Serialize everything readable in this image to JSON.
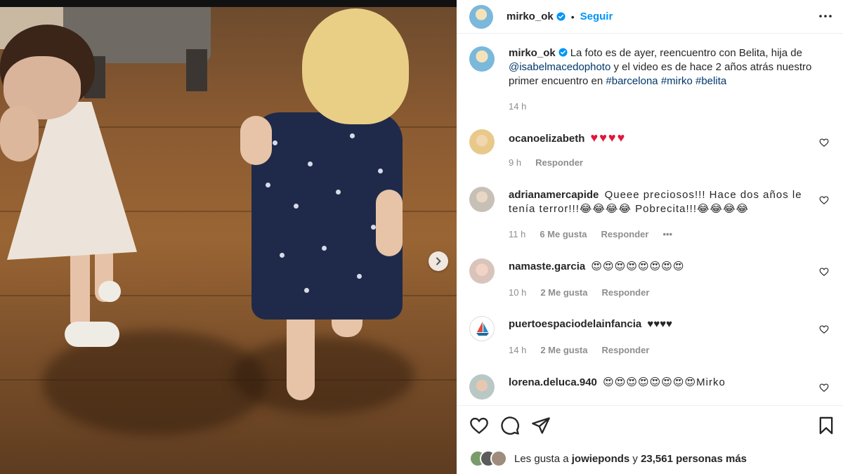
{
  "post": {
    "username": "mirko_ok",
    "dot": "•",
    "follow_label": "Seguir",
    "caption_parts": {
      "text1": "La foto es de ayer, reencuentro con Belita, hija de ",
      "mention": "@isabelmacedophoto",
      "text2": " y el video es de hace 2 años atrás nuestro primer encuentro en ",
      "tag1": "#barcelona",
      "tag2": "#mirko",
      "tag3": "#belita"
    },
    "caption_time": "14 h"
  },
  "comments": [
    {
      "user": "ocanoelizabeth",
      "text": "",
      "hearts": "♥♥♥♥",
      "time": "9 h",
      "likes": "",
      "reply": "Responder"
    },
    {
      "user": "adrianamercapide",
      "text": "Queee preciosos!!! Hace dos años le tenía terror!!!😂😂😂😂 Pobrecita!!!😂😂😂😂",
      "time": "11 h",
      "likes": "6 Me gusta",
      "reply": "Responder",
      "more": "•••"
    },
    {
      "user": "namaste.garcia",
      "text": "😍😍😍😍😍😍😍😍",
      "time": "10 h",
      "likes": "2 Me gusta",
      "reply": "Responder"
    },
    {
      "user": "puertoespaciodelainfancia",
      "text": "♥♥♥♥",
      "time": "14 h",
      "likes": "2 Me gusta",
      "reply": "Responder"
    },
    {
      "user": "lorena.deluca.940",
      "text": "😍😍😍😍😍😍😍😍Mirko"
    }
  ],
  "likes_line": {
    "prefix": "Les gusta a",
    "user": "jowieponds",
    "joiner": "y",
    "count": "23,561 personas más"
  },
  "icons": {
    "next": "chevron-right-icon",
    "more": "more-horizontal-icon",
    "verified": "verified-badge-icon",
    "heart": "heart-icon",
    "comment": "comment-icon",
    "share": "share-icon",
    "save": "bookmark-icon"
  },
  "colors": {
    "link_blue": "#0095f6",
    "mention": "#00376b",
    "meta_gray": "#8e8e8e",
    "heart_red": "#e0163a"
  }
}
